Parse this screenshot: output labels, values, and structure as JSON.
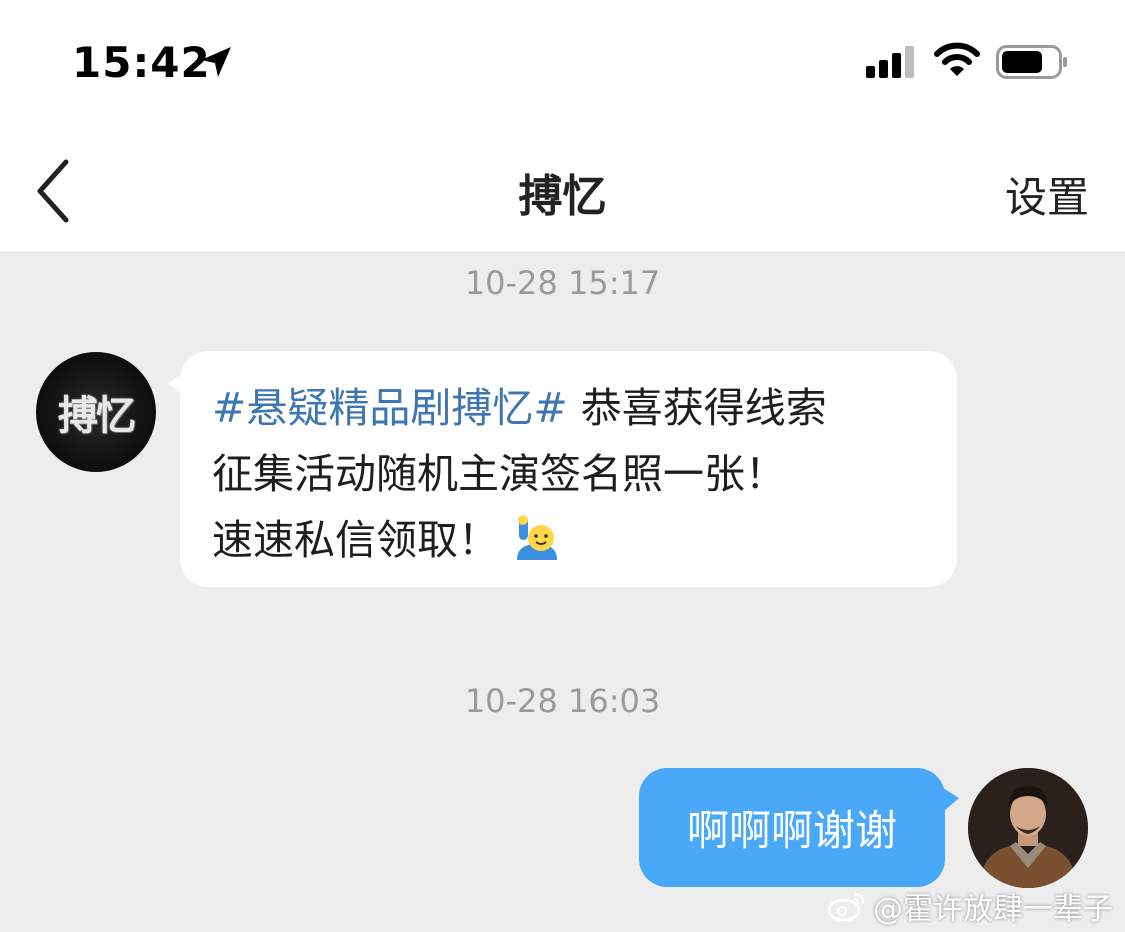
{
  "status_bar": {
    "time": "15:42",
    "icons": [
      "location-arrow-icon",
      "cellular-signal-icon",
      "wifi-icon",
      "battery-icon"
    ]
  },
  "nav": {
    "title": "搏忆",
    "settings_label": "设置",
    "back_icon": "chevron-left-icon"
  },
  "chat": {
    "messages": [
      {
        "timestamp": "10-28 15:17",
        "sender": "搏忆",
        "avatar_text": "搏忆",
        "hashtag": "#悬疑精品剧搏忆#",
        "line1_rest": " 恭喜获得线索",
        "line2": "征集活动随机主演签名照一张！",
        "line3": "速速私信领取！",
        "emoji": "raising-hand-emoji"
      },
      {
        "timestamp": "10-28 16:03",
        "text": "啊啊啊谢谢",
        "sender": "self"
      }
    ]
  },
  "watermark": {
    "text": "@霍许放肆一辈子",
    "icon": "weibo-logo-icon"
  },
  "colors": {
    "background": "#ededed",
    "hashtag": "#3d76b0",
    "outgoing_bubble": "#4aa8f8",
    "timestamp": "#9a9a9a"
  }
}
